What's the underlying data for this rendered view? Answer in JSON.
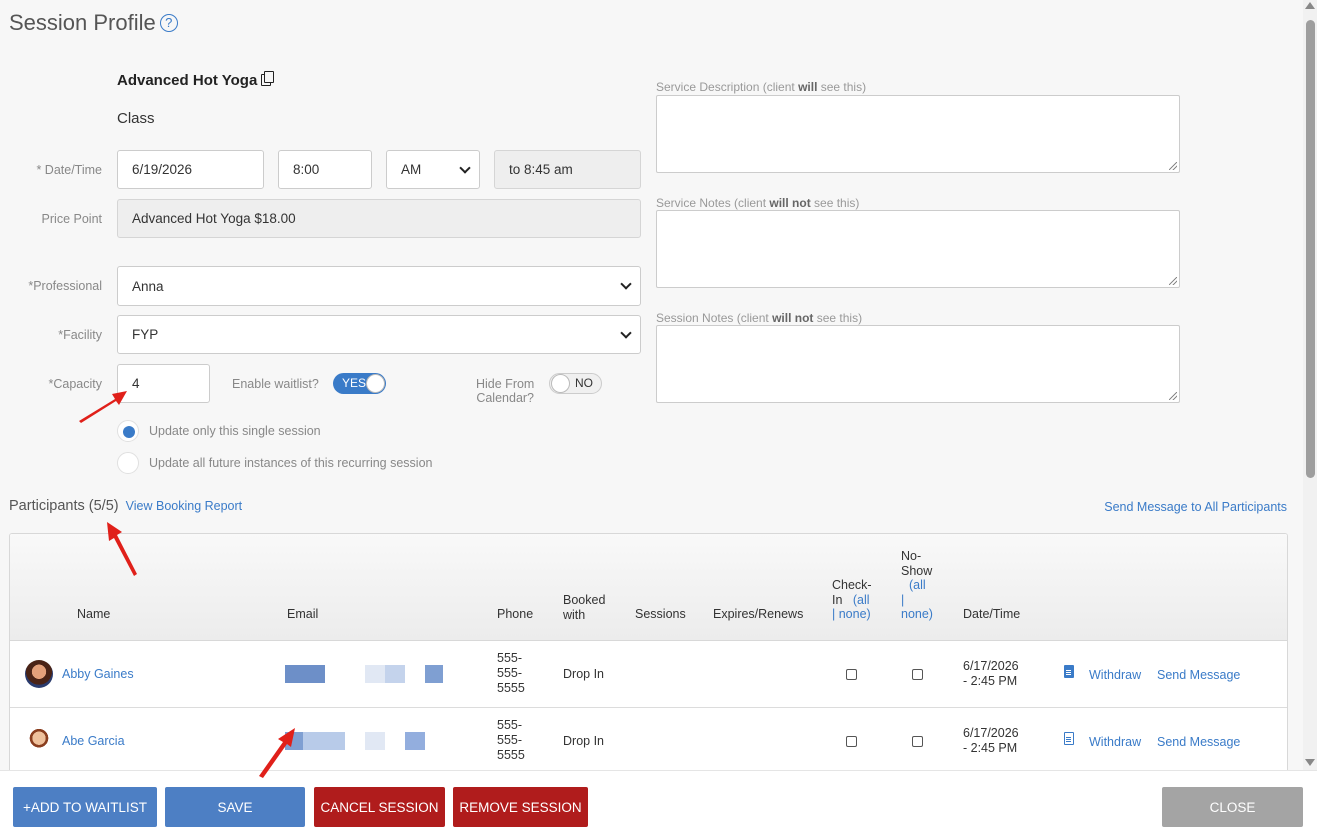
{
  "header": {
    "title": "Session Profile",
    "help_glyph": "?"
  },
  "service": {
    "name": "Advanced Hot Yoga",
    "type": "Class"
  },
  "form": {
    "datetime_label": "* Date/Time",
    "date": "6/19/2026",
    "time": "8:00",
    "ampm": "AM",
    "end_time": "to 8:45 am",
    "price_label": "Price Point",
    "price": "Advanced Hot Yoga $18.00",
    "professional_label": "*Professional",
    "professional": "Anna",
    "facility_label": "*Facility",
    "facility": "FYP",
    "capacity_label": "*Capacity",
    "capacity": "4",
    "waitlist_label": "Enable waitlist?",
    "waitlist_value": "YES",
    "hide_label_1": "Hide From",
    "hide_label_2": "Calendar?",
    "hide_value": "NO",
    "radio_single": "Update only this single session",
    "radio_all": "Update all future instances of this recurring session"
  },
  "notes": {
    "desc_label_pre": "Service Description (client ",
    "desc_label_bold": "will",
    "desc_label_post": " see this)",
    "svc_notes_pre": "Service Notes (client ",
    "svc_notes_bold": "will not",
    "svc_notes_post": " see this)",
    "session_notes_pre": "Session Notes (client ",
    "session_notes_bold": "will not",
    "session_notes_post": " see this)"
  },
  "participants": {
    "title": "Participants (5/5)",
    "report_link": "View Booking Report",
    "send_all": "Send Message to All Participants",
    "columns": {
      "name": "Name",
      "email": "Email",
      "phone": "Phone",
      "booked_1": "Booked",
      "booked_2": "with",
      "sessions": "Sessions",
      "expires": "Expires/Renews",
      "checkin_1": "Check-",
      "checkin_2": "In",
      "all": "(all",
      "pipe_none": "| none)",
      "noshow_1": "No-",
      "noshow_2": "Show",
      "noshow_all": "(all",
      "noshow_pipe": "|",
      "noshow_none": "none)",
      "datetime": "Date/Time"
    },
    "rows": [
      {
        "name": "Abby Gaines",
        "phone_1": "555-",
        "phone_2": "555-",
        "phone_3": "5555",
        "booked": "Drop In",
        "date_1": "6/17/2026",
        "date_2": "- 2:45 PM",
        "withdraw": "Withdraw",
        "send": "Send Message"
      },
      {
        "name": "Abe Garcia",
        "phone_1": "555-",
        "phone_2": "555-",
        "phone_3": "5555",
        "booked": "Drop In",
        "date_1": "6/17/2026",
        "date_2": "- 2:45 PM",
        "withdraw": "Withdraw",
        "send": "Send Message"
      }
    ]
  },
  "footer": {
    "add_waitlist": "+ADD TO WAITLIST",
    "save": "SAVE",
    "cancel_session": "CANCEL SESSION",
    "remove_session": "REMOVE SESSION",
    "close": "CLOSE"
  },
  "colors": {
    "accent": "#3a7bc8",
    "danger": "#b01c1c",
    "annotation_arrow": "#e0201a"
  }
}
